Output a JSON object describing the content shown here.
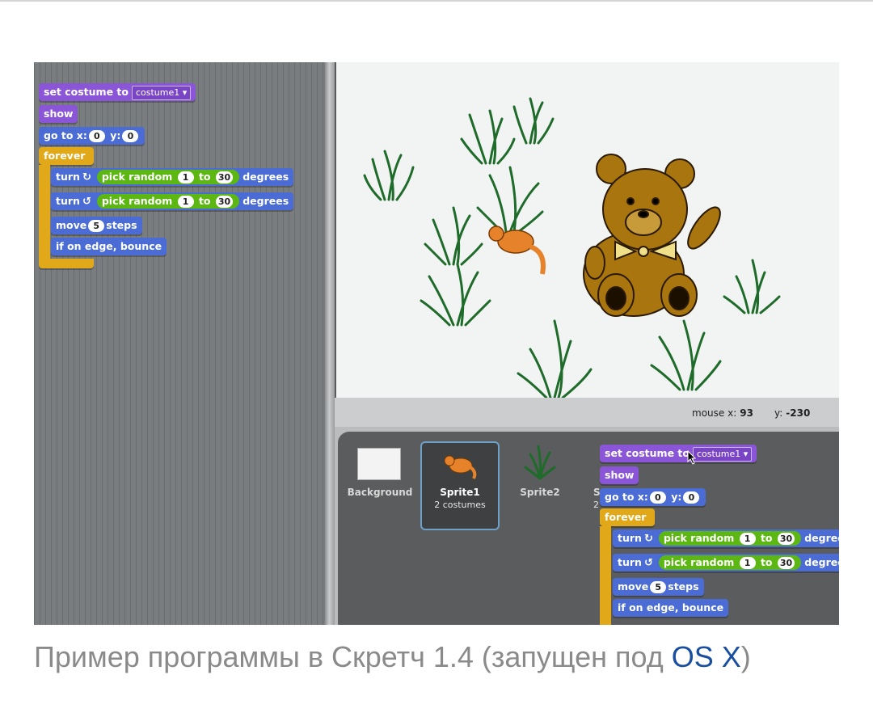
{
  "script": {
    "set_costume": "set costume to",
    "costume_value": "costume1",
    "show": "show",
    "goto_prefix": "go to x:",
    "goto_x": "0",
    "goto_y_label": "y:",
    "goto_y": "0",
    "forever": "forever",
    "turn": "turn",
    "pick_random": "pick random",
    "rand_from": "1",
    "rand_to_label": "to",
    "rand_to": "30",
    "degrees": "degrees",
    "move": "move",
    "move_steps": "5",
    "steps": "steps",
    "bounce": "if on edge, bounce"
  },
  "stage_info": {
    "mouse_x_label": "mouse x:",
    "mouse_x": "93",
    "mouse_y_label": "y:",
    "mouse_y": "-230"
  },
  "sprites": [
    {
      "name": "Background",
      "sub": ""
    },
    {
      "name": "Sprite1",
      "sub": "2 costumes"
    },
    {
      "name": "Sprite2",
      "sub": ""
    },
    {
      "name": "S",
      "sub": "2"
    }
  ],
  "caption": {
    "text": "Пример программы в Скретч 1.4 (запущен под ",
    "link": "OS X",
    "end": ")"
  },
  "colors": {
    "looks": "#8a55d7",
    "motion": "#4a6cd4",
    "control": "#e1a91a",
    "operator": "#5cb712",
    "caption_link": "#1a4fa0"
  }
}
